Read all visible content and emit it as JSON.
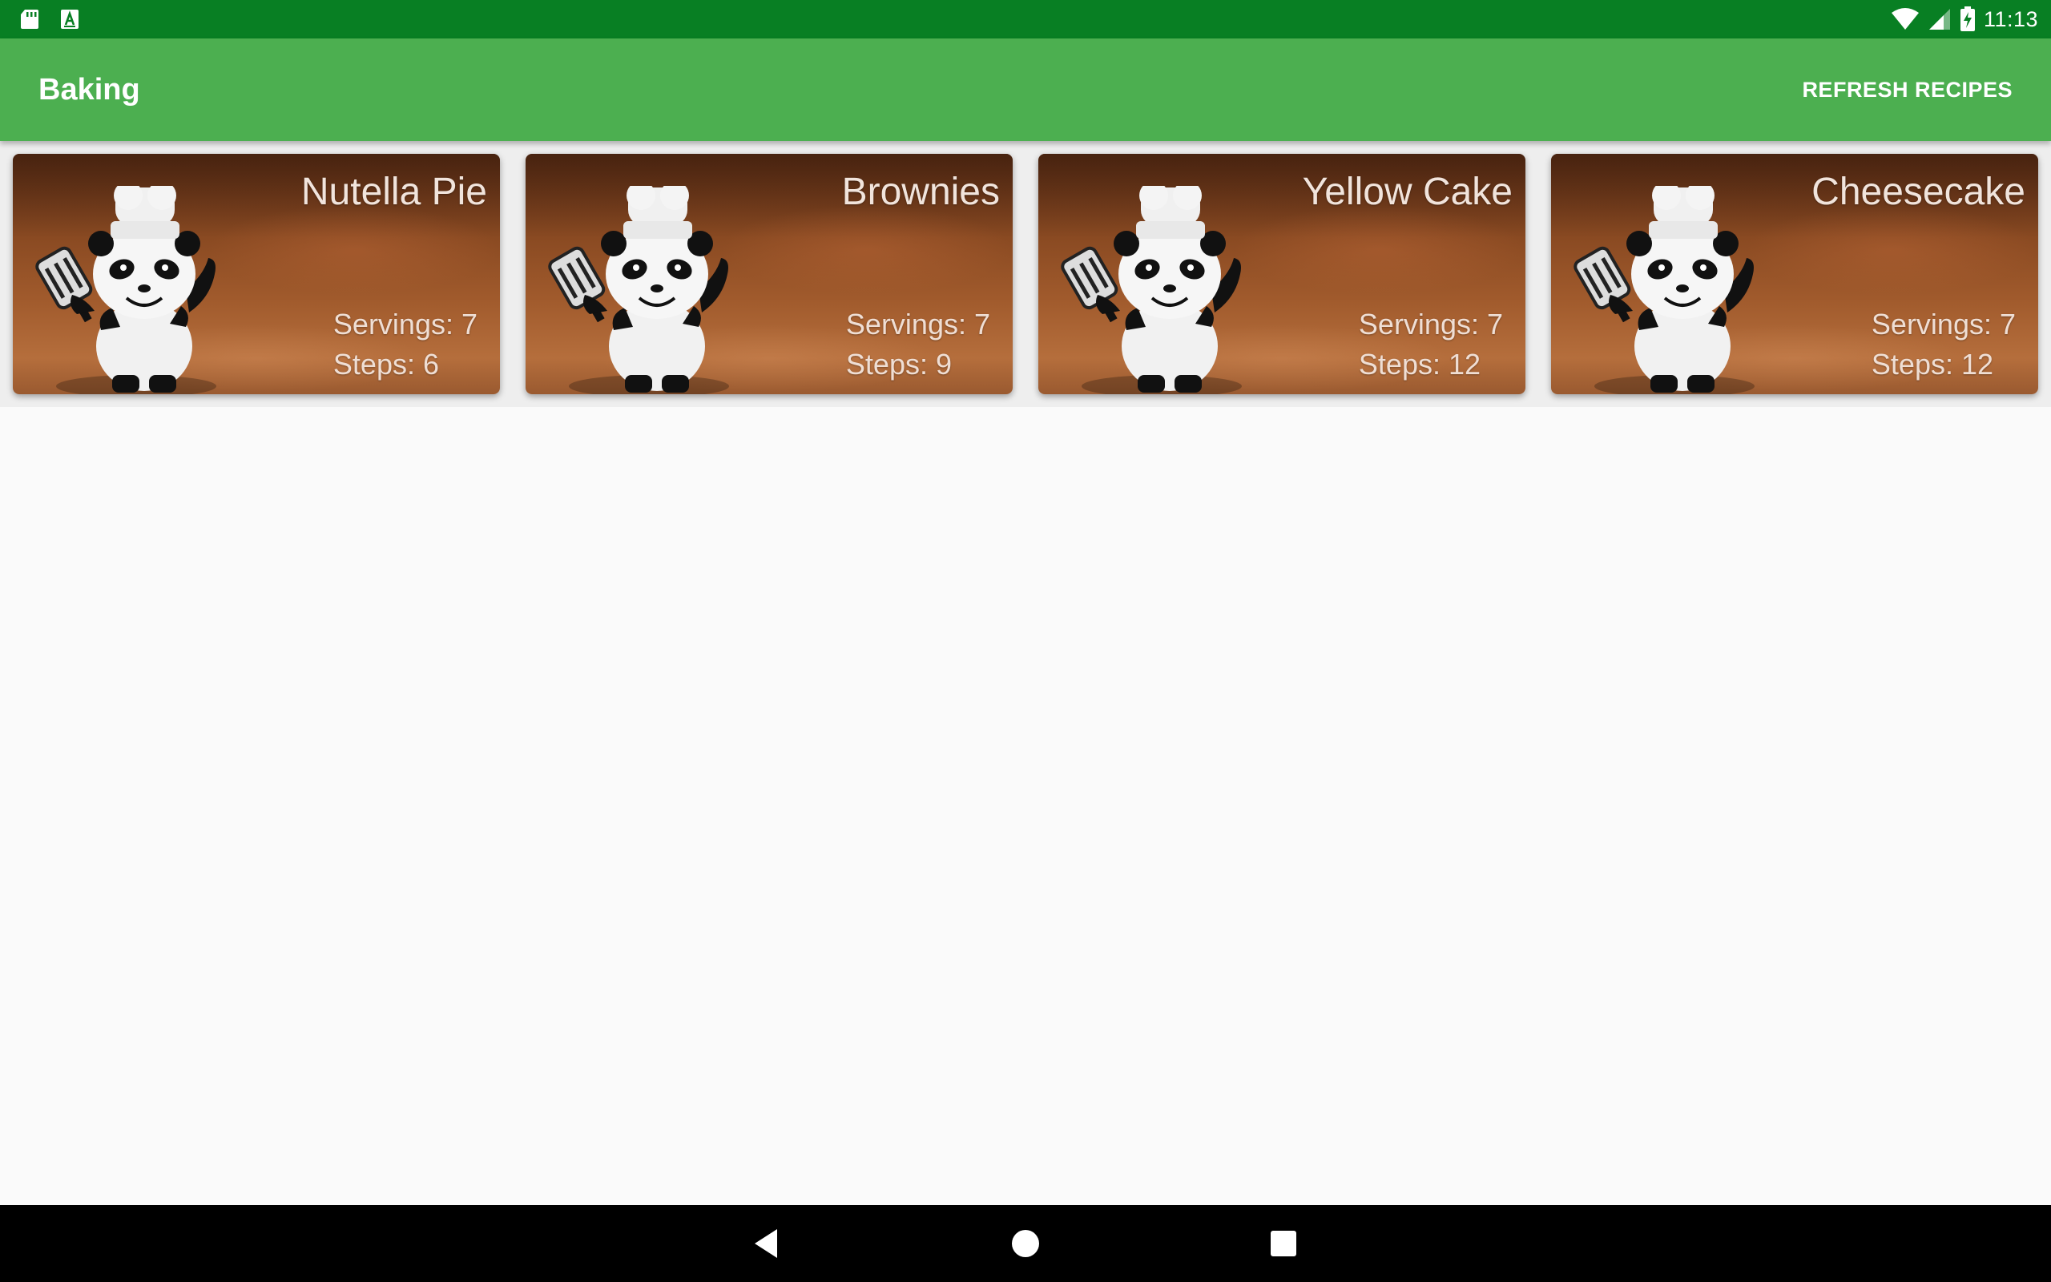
{
  "status_bar": {
    "time": "11:13",
    "left_icons": [
      "sd-card-icon",
      "keyboard-a-icon"
    ],
    "right_icons": [
      "wifi-icon",
      "signal-icon",
      "battery-charging-icon"
    ]
  },
  "app_bar": {
    "title": "Baking",
    "refresh_label": "REFRESH RECIPES",
    "color": "#4CAF50",
    "status_color": "#087F23"
  },
  "recipes": [
    {
      "name": "Nutella Pie",
      "servings": "Servings: 7",
      "steps": "Steps: 6"
    },
    {
      "name": "Brownies",
      "servings": "Servings: 7",
      "steps": "Steps: 9"
    },
    {
      "name": "Yellow Cake",
      "servings": "Servings: 7",
      "steps": "Steps: 12"
    },
    {
      "name": "Cheesecake",
      "servings": "Servings: 7",
      "steps": "Steps: 12"
    }
  ],
  "nav_bar": {
    "buttons": [
      "back-icon",
      "home-icon",
      "recents-icon"
    ]
  }
}
